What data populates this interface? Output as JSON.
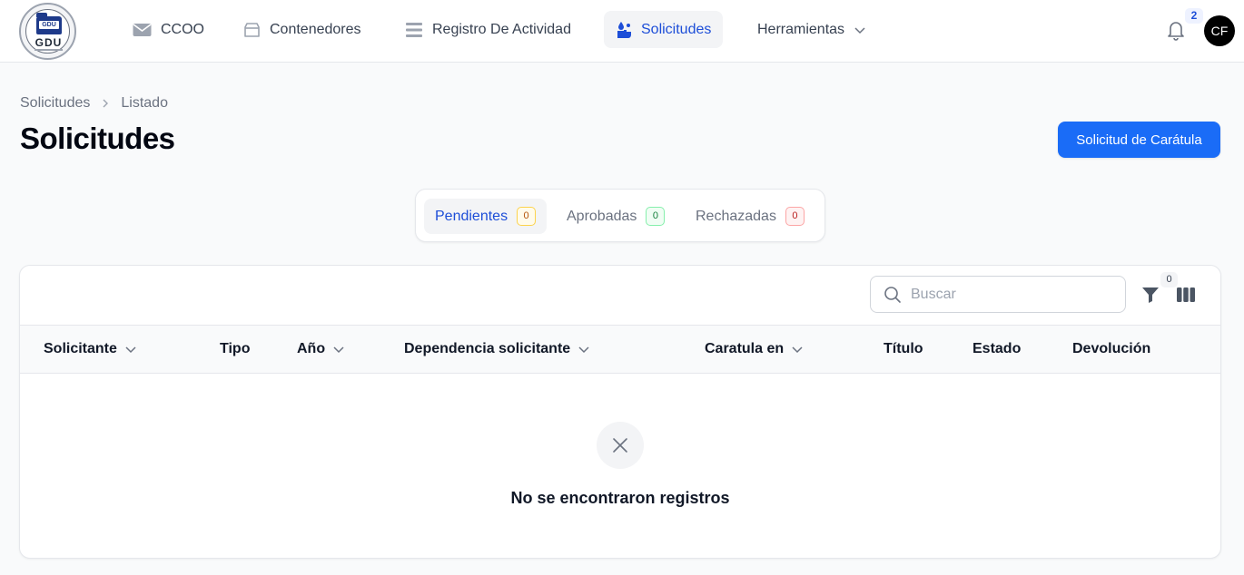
{
  "logo": {
    "top_text": "GDU",
    "main_text": "GDU"
  },
  "nav": {
    "items": [
      {
        "label": "CCOO",
        "icon": "envelope-icon",
        "active": false
      },
      {
        "label": "Contenedores",
        "icon": "inbox-icon",
        "active": false
      },
      {
        "label": "Registro De Actividad",
        "icon": "list-icon",
        "active": false
      },
      {
        "label": "Solicitudes",
        "icon": "hand-drop-icon",
        "active": true
      },
      {
        "label": "Herramientas",
        "icon": "chevron-down-icon",
        "active": false
      }
    ],
    "notifications_count": "2",
    "avatar_initials": "CF"
  },
  "breadcrumb": {
    "items": [
      "Solicitudes",
      "Listado"
    ]
  },
  "page": {
    "title": "Solicitudes",
    "primary_action": "Solicitud de Carátula"
  },
  "tabs": [
    {
      "label": "Pendientes",
      "count": "0",
      "color": "#b45309",
      "active": true
    },
    {
      "label": "Aprobadas",
      "count": "0",
      "color": "#15803d",
      "active": false
    },
    {
      "label": "Rechazadas",
      "count": "0",
      "color": "#b91c1c",
      "active": false
    }
  ],
  "table": {
    "search": {
      "placeholder": "Buscar",
      "value": ""
    },
    "filters_count": "0",
    "columns": [
      {
        "label": "Solicitante",
        "sortable": true
      },
      {
        "label": "Tipo",
        "sortable": false
      },
      {
        "label": "Año",
        "sortable": true
      },
      {
        "label": "Dependencia solicitante",
        "sortable": true
      },
      {
        "label": "Caratula en",
        "sortable": true
      },
      {
        "label": "Título",
        "sortable": false
      },
      {
        "label": "Estado",
        "sortable": false
      },
      {
        "label": "Devolución",
        "sortable": false
      }
    ],
    "rows": [],
    "empty_message": "No se encontraron registros"
  },
  "colors": {
    "primary": "#1a6cf7",
    "active_nav": "#1d4ed8"
  }
}
